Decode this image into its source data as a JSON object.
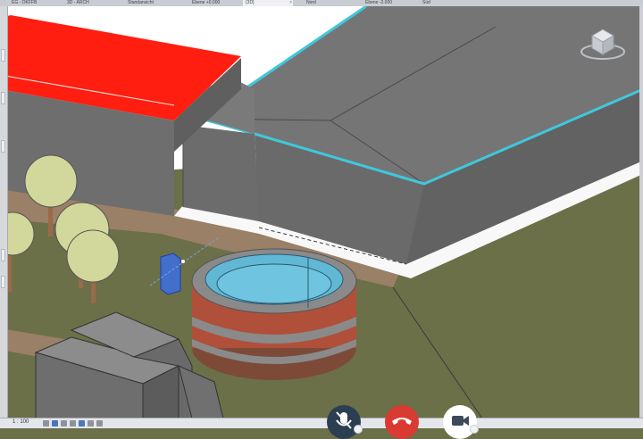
{
  "tabs": [
    {
      "label": "EG - OKFFB"
    },
    {
      "label": "3D - ARCH"
    },
    {
      "label": "Standansicht"
    },
    {
      "label": "Ebene +0.000"
    },
    {
      "label": "{3D}"
    },
    {
      "label": "Nord"
    },
    {
      "label": "Ebene -2.000"
    },
    {
      "label": "Süd"
    }
  ],
  "status": {
    "scale": "1 : 100"
  },
  "nav_cube": {
    "icon": "view-cube-icon"
  },
  "call_controls": {
    "mute_icon": "microphone-muted-icon",
    "end_icon": "phone-hangup-icon",
    "video_icon": "video-camera-icon"
  },
  "colors": {
    "terrain": "#6b7048",
    "building": "#6e6e6e",
    "roof_selected": "#3fc8dc",
    "red_roof": "#ff1e10",
    "path": "#9a8066",
    "tank_rim": "#61b8d4",
    "tank_body": "#b0503a",
    "tree_canopy": "#d2d79b",
    "end_call": "#d93a31",
    "mute": "#2c3f52"
  }
}
